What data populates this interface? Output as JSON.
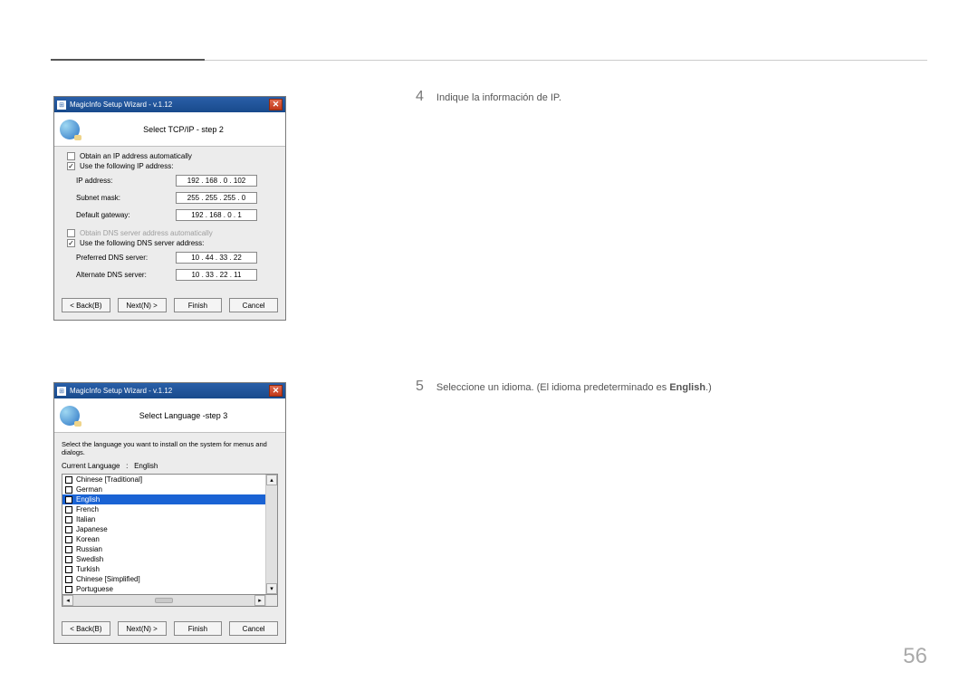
{
  "page_number": "56",
  "steps": {
    "s4": {
      "num": "4",
      "text": "Indique la información de IP."
    },
    "s5": {
      "num": "5",
      "text_pre": "Seleccione un idioma. (El idioma predeterminado es ",
      "text_bold": "English",
      "text_post": ".)"
    }
  },
  "dialog1": {
    "window_title": "MagicInfo Setup Wizard - v.1.12",
    "header_title": "Select TCP/IP - step 2",
    "opt_auto": {
      "label": "Obtain an IP address automatically",
      "checked": false
    },
    "opt_manual": {
      "label": "Use the following IP address:",
      "checked": true
    },
    "fields": {
      "ip": {
        "label": "IP address:",
        "value": "192 . 168 .   0  . 102"
      },
      "subnet": {
        "label": "Subnet mask:",
        "value": "255 . 255 . 255 .   0"
      },
      "gw": {
        "label": "Default gateway:",
        "value": "192 . 168 .   0  .   1"
      }
    },
    "dns_auto": {
      "label": "Obtain DNS server address automatically",
      "checked": false
    },
    "dns_manual": {
      "label": "Use the following DNS server address:",
      "checked": true
    },
    "dns_fields": {
      "pref": {
        "label": "Preferred DNS server:",
        "value": "10 .  44 .  33 .  22"
      },
      "alt": {
        "label": "Alternate DNS server:",
        "value": "10 .  33 .  22 .  11"
      }
    },
    "buttons": {
      "back": "< Back(B)",
      "next": "Next(N) >",
      "finish": "Finish",
      "cancel": "Cancel"
    }
  },
  "dialog2": {
    "window_title": "MagicInfo Setup Wizard - v.1.12",
    "header_title": "Select Language -step 3",
    "instruction": "Select the language you want to install on the system for menus and dialogs.",
    "current_label": "Current Language",
    "current_value": "English",
    "languages": [
      "Chinese [Traditional]",
      "German",
      "English",
      "French",
      "Italian",
      "Japanese",
      "Korean",
      "Russian",
      "Swedish",
      "Turkish",
      "Chinese [Simplified]",
      "Portuguese"
    ],
    "selected_index": 2,
    "buttons": {
      "back": "< Back(B)",
      "next": "Next(N) >",
      "finish": "Finish",
      "cancel": "Cancel"
    }
  }
}
